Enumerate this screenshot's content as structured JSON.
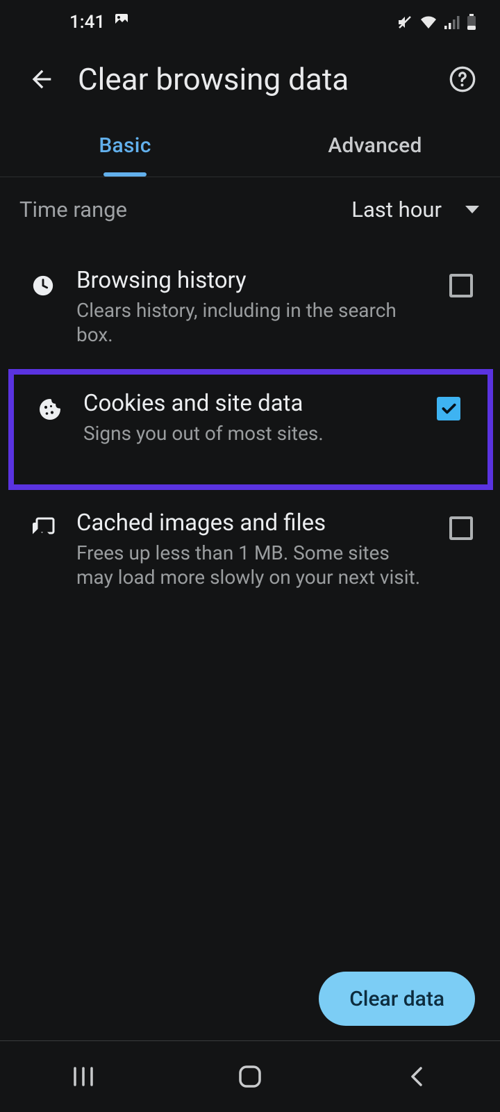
{
  "status": {
    "time": "1:41"
  },
  "header": {
    "title": "Clear browsing data"
  },
  "tabs": {
    "basic": "Basic",
    "advanced": "Advanced"
  },
  "time_range": {
    "label": "Time range",
    "value": "Last hour"
  },
  "items": [
    {
      "title": "Browsing history",
      "subtitle": "Clears history, including in the search box.",
      "checked": false
    },
    {
      "title": "Cookies and site data",
      "subtitle": "Signs you out of most sites.",
      "checked": true
    },
    {
      "title": "Cached images and files",
      "subtitle": "Frees up less than 1 MB. Some sites may load more slowly on your next visit.",
      "checked": false
    }
  ],
  "actions": {
    "clear": "Clear data"
  }
}
